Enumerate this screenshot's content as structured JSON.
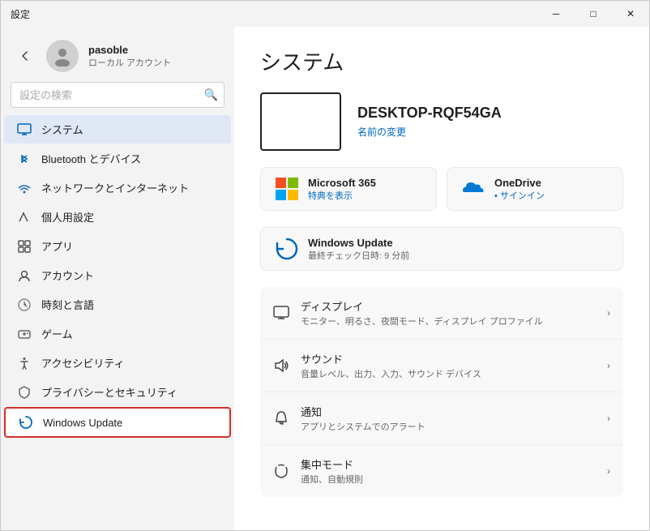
{
  "window": {
    "title": "設定",
    "controls": {
      "minimize": "─",
      "maximize": "□",
      "close": "✕"
    }
  },
  "sidebar": {
    "back_label": "←",
    "user": {
      "name": "pasoble",
      "subtitle": "ローカル アカウント"
    },
    "search": {
      "placeholder": "設定の検索"
    },
    "nav_items": [
      {
        "id": "system",
        "label": "システム",
        "active": true
      },
      {
        "id": "bluetooth",
        "label": "Bluetooth とデバイス",
        "active": false
      },
      {
        "id": "network",
        "label": "ネットワークとインターネット",
        "active": false
      },
      {
        "id": "personalization",
        "label": "個人用設定",
        "active": false
      },
      {
        "id": "apps",
        "label": "アプリ",
        "active": false
      },
      {
        "id": "accounts",
        "label": "アカウント",
        "active": false
      },
      {
        "id": "time",
        "label": "時刻と言語",
        "active": false
      },
      {
        "id": "gaming",
        "label": "ゲーム",
        "active": false
      },
      {
        "id": "accessibility",
        "label": "アクセシビリティ",
        "active": false
      },
      {
        "id": "privacy",
        "label": "プライバシーとセキュリティ",
        "active": false
      },
      {
        "id": "windows-update",
        "label": "Windows Update",
        "active": false,
        "highlighted": true
      }
    ]
  },
  "main": {
    "page_title": "システム",
    "device": {
      "name": "DESKTOP-RQF54GA",
      "rename_label": "名前の変更"
    },
    "quick_cards": [
      {
        "id": "ms365",
        "title": "Microsoft 365",
        "sub": "特典を表示"
      },
      {
        "id": "onedrive",
        "title": "OneDrive",
        "sub": "サインイン"
      }
    ],
    "windows_update": {
      "title": "Windows Update",
      "sub": "最終チェック日時: 9 分前"
    },
    "settings_items": [
      {
        "id": "display",
        "title": "ディスプレイ",
        "sub": "モニター、明るさ、夜間モード、ディスプレイ プロファイル"
      },
      {
        "id": "sound",
        "title": "サウンド",
        "sub": "音量レベル、出力、入力、サウンド デバイス"
      },
      {
        "id": "notifications",
        "title": "通知",
        "sub": "アプリとシステムでのアラート"
      },
      {
        "id": "focus",
        "title": "集中モード",
        "sub": "通知、自動規則"
      }
    ]
  }
}
